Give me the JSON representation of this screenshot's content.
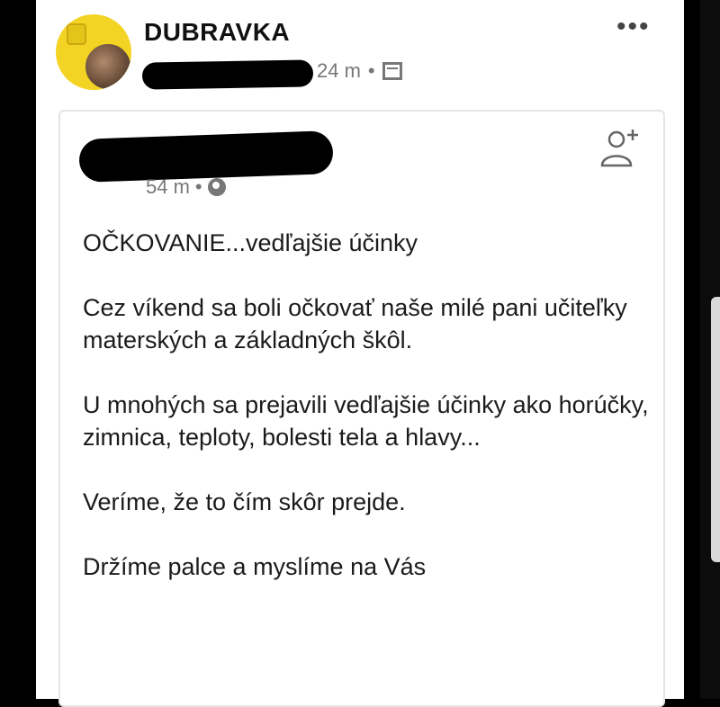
{
  "header": {
    "page_name": "DUBRAVKA",
    "time": "24 m",
    "separator": "•"
  },
  "shared_post": {
    "time": "54 m",
    "separator": "•",
    "paragraphs": [
      "OČKOVANIE...vedľajšie účinky",
      "Cez víkend sa boli očkovať naše milé pani učiteľky materských a základných škôl.",
      "U mnohých sa prejavili vedľajšie účinky ako horúčky, zimnica, teploty, bolesti tela a hlavy...",
      "Veríme, že to čím skôr prejde.",
      "Držíme palce a myslíme na Vás"
    ]
  },
  "icons": {
    "menu": "more-dots-icon",
    "calendar": "calendar-icon",
    "globe": "globe-icon",
    "add_friend": "add-friend-icon"
  },
  "colors": {
    "avatar_bg": "#f3d323",
    "meta_text": "#777777",
    "text": "#1b1b1b"
  }
}
